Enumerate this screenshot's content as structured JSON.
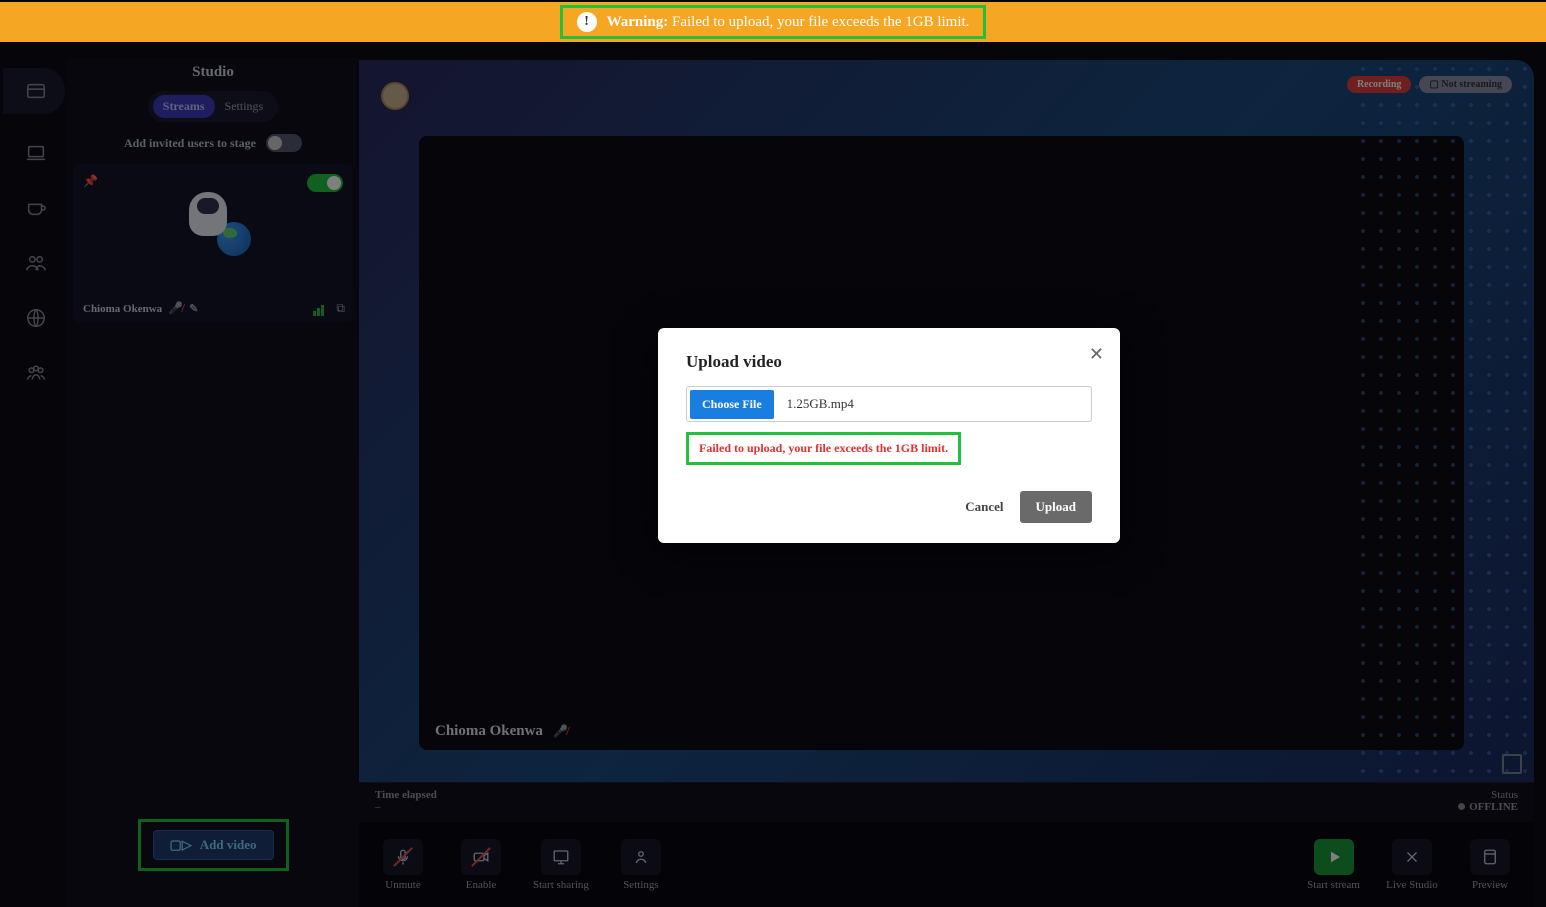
{
  "banner": {
    "prefix": "Warning:",
    "message": "Failed to upload, your file exceeds the 1GB limit."
  },
  "studio": {
    "title": "Studio",
    "tabs": {
      "streams": "Streams",
      "settings": "Settings"
    },
    "invite_label": "Add invited users to stage",
    "participant_name": "Chioma Okenwa",
    "add_video_label": "Add video"
  },
  "stage": {
    "badges": {
      "recording": "Recording",
      "not_streaming": "Not streaming"
    },
    "overlay_name": "Chioma Okenwa"
  },
  "status": {
    "time_label": "Time elapsed",
    "time_value": "–",
    "status_label": "Status",
    "status_value": "OFFLINE"
  },
  "toolbar": {
    "unmute": "Unmute",
    "enable": "Enable",
    "share": "Start sharing",
    "settings": "Settings",
    "start": "Start stream",
    "live": "Live Studio",
    "preview": "Preview"
  },
  "modal": {
    "title": "Upload video",
    "choose": "Choose File",
    "filename": "1.25GB.mp4",
    "error": "Failed to upload, your file exceeds the 1GB limit.",
    "cancel": "Cancel",
    "upload": "Upload"
  }
}
